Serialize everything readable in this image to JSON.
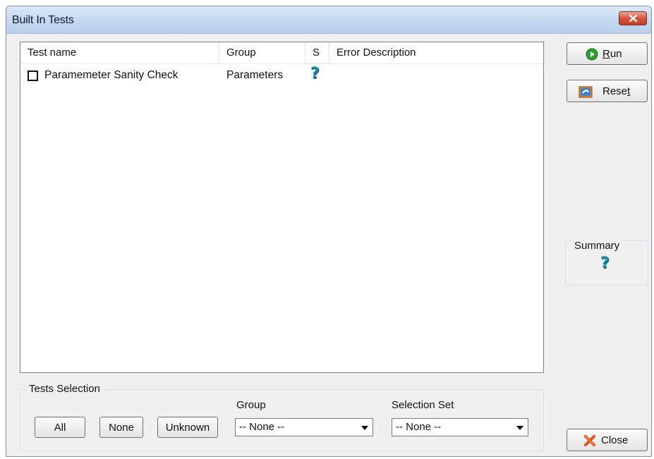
{
  "window": {
    "title": "Built In Tests"
  },
  "columns": [
    "Test name",
    "Group",
    "S",
    "Error Description"
  ],
  "tests": [
    {
      "name": "Paramemeter Sanity Check",
      "group": "Parameters",
      "status_symbol": "?",
      "error": "",
      "checked": false
    }
  ],
  "buttons": {
    "run": {
      "label": "Run",
      "icon": "play-icon"
    },
    "reset": {
      "label": "Reset",
      "icon": "reset-icon"
    },
    "close": {
      "label": "Close",
      "icon": "close-x-icon"
    }
  },
  "summary": {
    "label": "Summary",
    "symbol": "?"
  },
  "selection": {
    "label": "Tests Selection",
    "buttons": [
      "All",
      "None",
      "Unknown"
    ],
    "group": {
      "label": "Group",
      "value": "-- None --"
    },
    "selection_set": {
      "label": "Selection Set",
      "value": "-- None --"
    }
  },
  "colors": {
    "status_icon": "#1a8aa6",
    "titlebar": "#c4d8ef"
  }
}
